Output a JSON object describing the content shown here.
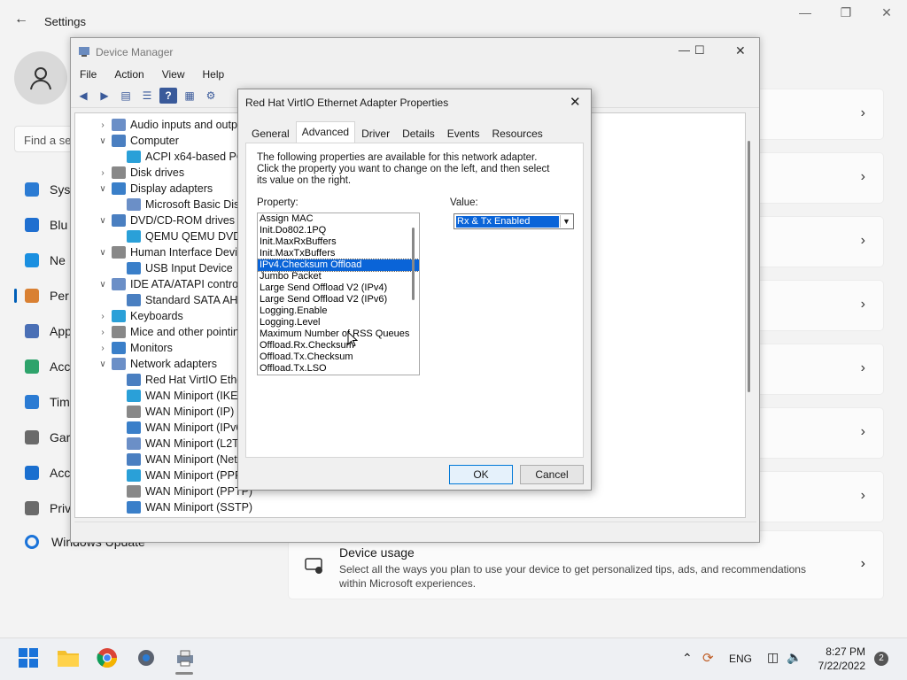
{
  "settings": {
    "title": "Settings",
    "search_placeholder": "Find a se",
    "nav": [
      {
        "label": "Sys",
        "icon": "display-icon",
        "color": "#2b7bd3"
      },
      {
        "label": "Blu",
        "icon": "bluetooth-icon",
        "color": "#1f6fd0"
      },
      {
        "label": "Ne",
        "icon": "wifi-icon",
        "color": "#1a8fe0"
      },
      {
        "label": "Per",
        "icon": "brush-icon",
        "color": "#d98032"
      },
      {
        "label": "App",
        "icon": "apps-icon",
        "color": "#4a6fb5"
      },
      {
        "label": "Acc",
        "icon": "account-icon",
        "color": "#2ea36b"
      },
      {
        "label": "Tim",
        "icon": "clock-icon",
        "color": "#2b7bd3"
      },
      {
        "label": "Gar",
        "icon": "gamepad-icon",
        "color": "#6a6a6a"
      },
      {
        "label": "Acc",
        "icon": "accessibility-icon",
        "color": "#1a6fcf"
      },
      {
        "label": "Priv",
        "icon": "shield-icon",
        "color": "#6a6a6a"
      }
    ],
    "windows_update": "Windows Update",
    "device_usage": {
      "title": "Device usage",
      "description": "Select all the ways you plan to use your device to get personalized tips, ads, and recommendations within Microsoft experiences."
    }
  },
  "device_manager": {
    "title": "Device Manager",
    "menu": [
      "File",
      "Action",
      "View",
      "Help"
    ],
    "tree": [
      {
        "label": "Audio inputs and output",
        "toggle": ">",
        "level": 0
      },
      {
        "label": "Computer",
        "toggle": "v",
        "level": 0
      },
      {
        "label": "ACPI x64-based PC",
        "toggle": "",
        "level": 1
      },
      {
        "label": "Disk drives",
        "toggle": ">",
        "level": 0
      },
      {
        "label": "Display adapters",
        "toggle": "v",
        "level": 0
      },
      {
        "label": "Microsoft Basic Disp",
        "toggle": "",
        "level": 1
      },
      {
        "label": "DVD/CD-ROM drives",
        "toggle": "v",
        "level": 0
      },
      {
        "label": "QEMU QEMU DVD-",
        "toggle": "",
        "level": 1
      },
      {
        "label": "Human Interface Devic",
        "toggle": "v",
        "level": 0
      },
      {
        "label": "USB Input Device",
        "toggle": "",
        "level": 1
      },
      {
        "label": "IDE ATA/ATAPI controlle",
        "toggle": "v",
        "level": 0
      },
      {
        "label": "Standard SATA AHC",
        "toggle": "",
        "level": 1
      },
      {
        "label": "Keyboards",
        "toggle": ">",
        "level": 0
      },
      {
        "label": "Mice and other pointin",
        "toggle": ">",
        "level": 0
      },
      {
        "label": "Monitors",
        "toggle": ">",
        "level": 0
      },
      {
        "label": "Network adapters",
        "toggle": "v",
        "level": 0
      },
      {
        "label": "Red Hat VirtIO Ether",
        "toggle": "",
        "level": 1
      },
      {
        "label": "WAN Miniport (IKEv",
        "toggle": "",
        "level": 1
      },
      {
        "label": "WAN Miniport (IP)",
        "toggle": "",
        "level": 1
      },
      {
        "label": "WAN Miniport (IPv6",
        "toggle": "",
        "level": 1
      },
      {
        "label": "WAN Miniport (L2T",
        "toggle": "",
        "level": 1
      },
      {
        "label": "WAN Miniport (Net",
        "toggle": "",
        "level": 1
      },
      {
        "label": "WAN Miniport (PPP",
        "toggle": "",
        "level": 1
      },
      {
        "label": "WAN Miniport (PPTP)",
        "toggle": "",
        "level": 1
      },
      {
        "label": "WAN Miniport (SSTP)",
        "toggle": "",
        "level": 1
      }
    ]
  },
  "dialog": {
    "title": "Red Hat VirtIO Ethernet Adapter Properties",
    "tabs": [
      "General",
      "Advanced",
      "Driver",
      "Details",
      "Events",
      "Resources"
    ],
    "active_tab": "Advanced",
    "description": "The following properties are available for this network adapter. Click the property you want to change on the left, and then select its value on the right.",
    "property_label": "Property:",
    "value_label": "Value:",
    "properties": [
      "Assign MAC",
      "Init.Do802.1PQ",
      "Init.MaxRxBuffers",
      "Init.MaxTxBuffers",
      "IPv4.Checksum Offload",
      "Jumbo Packet",
      "Large Send Offload V2 (IPv4)",
      "Large Send Offload V2 (IPv6)",
      "Logging.Enable",
      "Logging.Level",
      "Maximum Number of RSS Queues",
      "Offload.Rx.Checksum",
      "Offload.Tx.Checksum",
      "Offload.Tx.LSO"
    ],
    "selected_property": "IPv4.Checksum Offload",
    "value": "Rx & Tx Enabled",
    "ok_label": "OK",
    "cancel_label": "Cancel"
  },
  "taskbar": {
    "lang": "ENG",
    "time": "8:27 PM",
    "date": "7/22/2022",
    "notification_count": "2"
  }
}
